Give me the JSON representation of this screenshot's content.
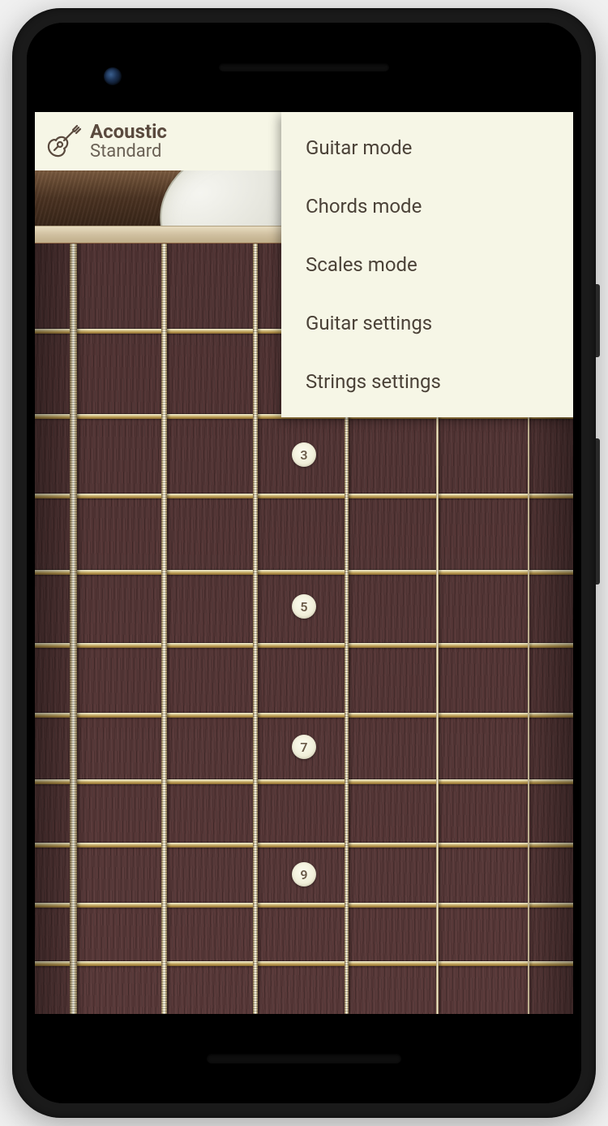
{
  "header": {
    "title": "Acoustic",
    "subtitle": "Standard"
  },
  "menu": {
    "items": [
      "Guitar mode",
      "Chords mode",
      "Scales mode",
      "Guitar settings",
      "Strings settings"
    ]
  },
  "fretboard": {
    "markers": [
      {
        "fret": 3,
        "label": "3"
      },
      {
        "fret": 5,
        "label": "5"
      },
      {
        "fret": 7,
        "label": "7"
      },
      {
        "fret": 9,
        "label": "9"
      }
    ],
    "strings": 6
  }
}
